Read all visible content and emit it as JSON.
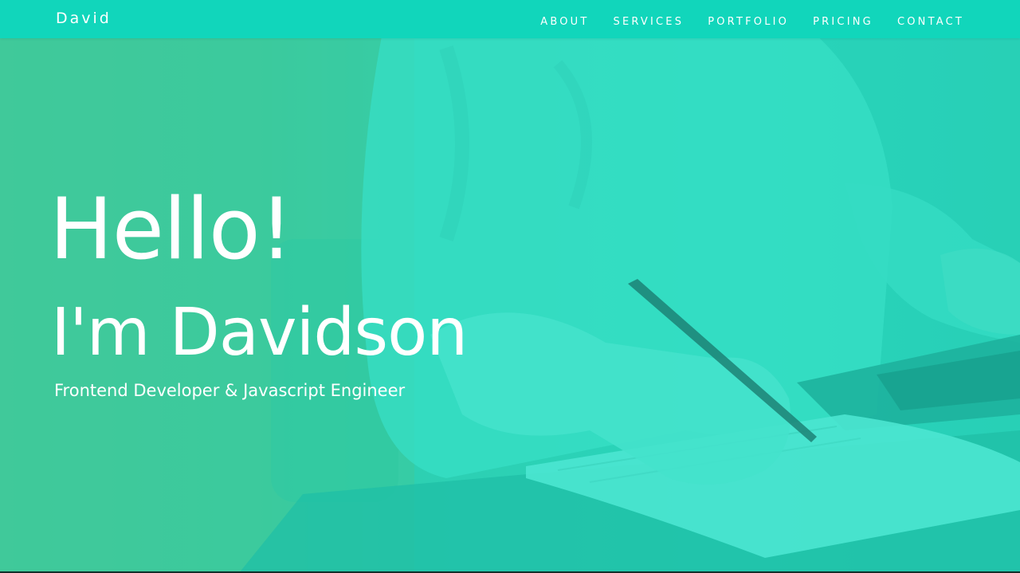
{
  "navbar": {
    "brand": "David",
    "links": [
      "ABOUT",
      "SERVICES",
      "PORTFOLIO",
      "PRICING",
      "CONTACT"
    ]
  },
  "hero": {
    "greeting": "Hello!",
    "name": "I'm Davidson",
    "tagline": "Frontend Developer & Javascript Engineer",
    "background_icon": "person-writing-photo"
  },
  "colors": {
    "navbar": "#11d6bb",
    "overlay": "#2ed3bb",
    "text": "#ffffff"
  }
}
